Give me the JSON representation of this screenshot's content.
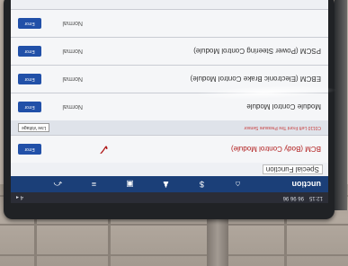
{
  "toolbar": {
    "title": "unction",
    "icons": [
      "home-icon",
      "dollar-icon",
      "person-icon",
      "printer-icon",
      "list-icon",
      "back-icon"
    ]
  },
  "statusbar": {
    "time": "12:15",
    "indicators": "96 96 96",
    "right": "4 ◂"
  },
  "special_function": {
    "label": "Special Function"
  },
  "modules": [
    {
      "name": "BCM (Body Control Module)",
      "status": "",
      "button": "Error",
      "marked": true,
      "sub_text": "C0110 Left Front Tire Pressure Sensor",
      "sub_button": "Live Voltage"
    },
    {
      "name": "Module Control Module",
      "status": "Normal",
      "button": "Error",
      "marked": false
    },
    {
      "name": "EBCM (Electronic Brake Control Module)",
      "status": "Normal",
      "button": "Error",
      "marked": false
    },
    {
      "name": "PSCM (Power Steering Control Module)",
      "status": "Normal",
      "button": "Error",
      "marked": false
    },
    {
      "name": "",
      "status": "Normal",
      "button": "Error",
      "marked": false
    }
  ],
  "colors": {
    "toolbar": "#1b3f78",
    "button": "#2150a8",
    "error_text": "#b01a1a"
  }
}
